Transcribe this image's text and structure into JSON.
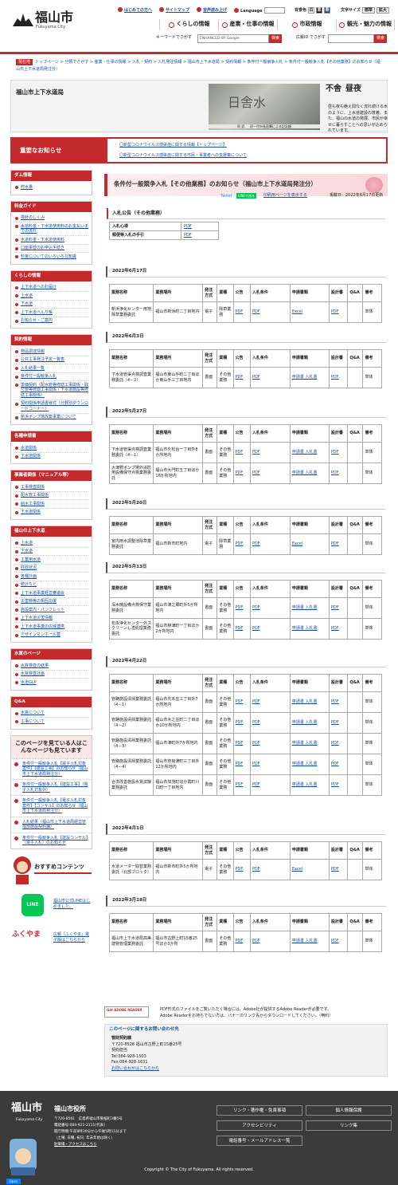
{
  "header": {
    "logo_jp": "福山市",
    "logo_en": "Fukuyama City",
    "toplinks": [
      "はじめての方へ",
      "サイトマップ",
      "音声読み上げ",
      "Language"
    ],
    "bg_label": "背景色",
    "bg_opts": [
      "白",
      "黒",
      "青"
    ],
    "fs_label": "文字サイズ",
    "fs_opts": [
      "標準",
      "拡大"
    ],
    "nav": [
      "くらしの情報",
      "産業・仕事の情報",
      "市政情報",
      "観光・魅力の情報"
    ],
    "search_label": "キーワードでさがす",
    "search_placeholder": "ENHANCED BY Google",
    "search_btn": "検索",
    "ad_label": "広報ID でさがす",
    "ad_btn": "検索"
  },
  "breadcrumb": {
    "home": "現在地",
    "trail": "トップページ > 分類でさがす > 産業・仕事の情報 > 入札・契約 > 入札発注情報 > 福山市上下水道局 > 契約情報 > 条件付一般競争入札 > 条件付一般競争入札【その他業務】のお知らせ（福山市上下水道局発注分）"
  },
  "dept": {
    "title": "福山市上下水道局",
    "caption": "阿 武 　 初一代市長直筆による記念額",
    "kanji": "日舎水",
    "cal1": "不舎",
    "cal2": "昼夜",
    "desc": "昼も夜も絶え間なく流れ続ける水のように、上水道建設の意義、また、福山の水道の発展、市民が幸せに暮らすことへの思いが込められています。"
  },
  "notice": {
    "label": "重要なお知らせ",
    "items": [
      "〇新型コロナウイルス感染症に関する情報【トップページ】",
      "〇新型コロナウイルス感染症に関する市民・事業者への支援策について"
    ]
  },
  "sidebar": {
    "groups": [
      {
        "title": "ダム情報",
        "items": [
          "貯水量"
        ]
      },
      {
        "title": "料金ガイド",
        "items": [
          "検針のしくみ",
          "水道料金・下水道使用料のお支払いまでの流れ",
          "水道料金・下水道使用料",
          "口座振替のお申込手続き",
          "料金についてのいろいろな知識"
        ]
      },
      {
        "title": "くらしの情報",
        "items": [
          "上下水道へのお届け",
          "上水道",
          "下水道",
          "上下水道べんり帳",
          "お知らせ・ご案内"
        ]
      },
      {
        "title": "契約情報",
        "items": [
          "物品調達情報",
          "公共工事発注予定一覧表",
          "入札結果一覧",
          "条件付一般競争入札",
          "単価契約（配水管等修繕工事関係・取付管等修繕工事関係・下水道施設等修繕工事関係）",
          "契約関係申請書様式（分野別ダウンロードコーナー）",
          "新浜ポンプ場改築事業について"
        ]
      },
      {
        "title": "各種申請書",
        "items": [
          "水道関係",
          "下水道関係"
        ]
      },
      {
        "title": "事業者関係（マニュアル等）",
        "items": [
          "工事検査関係",
          "配水管工事関係",
          "給水工事関係",
          "下水道関係"
        ]
      },
      {
        "title": "福山の上下水道",
        "items": [
          "上水道",
          "下水道",
          "工業用水道",
          "財政状況",
          "各種計画",
          "統計など",
          "上下水道事業経営審議会",
          "災害時等の相互応援",
          "施設案内・パンフレット",
          "上下水道災害情報",
          "上下水道事業の広域連携",
          "デザインマンホール蓋"
        ]
      },
      {
        "title": "水質のページ",
        "items": [
          "水質検査の結果",
          "水質検査計画",
          "水道GLP"
        ]
      },
      {
        "title": "Q&A",
        "items": [
          "水質について",
          "工事について"
        ]
      }
    ]
  },
  "popular": {
    "title": "このページを見ている人はこんなページも見ています",
    "items": [
      "条件付一般競争入札【電子入札対象案件】【建設工事】のお知らせ（福山市上下水道局発注分）",
      "条件付一般競争入札【建設工事】（電子入札対象外）",
      "条件付一般競争入札【電子入札対象案件】【コンサル】のお知らせ（福山市上下水道局発注分）",
      "入札結果（福山市上下水道局経営管理部施設契約課）",
      "条件付一般競争入札【建設コンサル】（電子入札）のお知らせ"
    ]
  },
  "recommend": {
    "title": "おすすめコンテンツ",
    "line_text": "福山市公式LINEはじめました。",
    "line_icon": "LINE",
    "fukuyama_text": "広報「ふくやま」電子版はこちらから",
    "fukuyama_icon": "ふくやま"
  },
  "main": {
    "title": "条件付一般競争入札【その他業務】のお知らせ（福山市上下水道局発注分）",
    "tweet": "Tweet",
    "line": "LINEで送る",
    "print": "印刷用ページを表示する",
    "date": "掲載日：2022年6月17日更新",
    "section": "入札公告（その他業務）",
    "pdfs": [
      {
        "name": "入札心得",
        "link": "PDF"
      },
      {
        "name": "郵便等入札の手引",
        "link": "PDF"
      }
    ],
    "headers": [
      "業務名称",
      "業務場所",
      "発注方式",
      "業種",
      "公告",
      "入札条件",
      "申請書類",
      "設計書",
      "Q&A",
      "備考"
    ],
    "blocks": [
      {
        "date": "2022年6月17日",
        "rows": [
          [
            "新浜浄化センター用地除草業務委託",
            "福山市新浜町二丁目地内",
            "電子",
            "除草業務",
            "PDF",
            "PDF",
            "Excel",
            "PDF",
            "",
            "単体"
          ]
        ]
      },
      {
        "date": "2022年6月3日",
        "rows": [
          [
            "下水道管渠点検調査業務委託（4－2）",
            "福山市東山手町二丁目ほか東山手三丁目地内",
            "書面",
            "その他業務",
            "PDF",
            "PDF",
            "申請書 入札書",
            "PDF",
            "",
            "単体"
          ]
        ]
      },
      {
        "date": "2022年5月27日",
        "rows": [
          [
            "下水道管渠点検調査業務委託（4－1）",
            "福山市久松台一丁目外8か所地内",
            "書面",
            "その他業務",
            "PDF",
            "PDF",
            "申請書 入札書",
            "PDF",
            "",
            "単体"
          ],
          [
            "大津野ポンプ場外消防用設備保守点検業務委託",
            "福山市大門町五丁目ほか16か所地内",
            "書面",
            "その他業務",
            "PDF",
            "PDF",
            "申請書 入札書",
            "PDF",
            "",
            "単体"
          ]
        ]
      },
      {
        "date": "2022年5月20日",
        "rows": [
          [
            "宮内雨水調整池除草業務委託",
            "福山市新市町地内",
            "電子",
            "除草業務",
            "PDF",
            "PDF",
            "Excel",
            "PDF",
            "",
            "単体"
          ]
        ]
      },
      {
        "date": "2022年5月13日",
        "rows": [
          [
            "深水機設備点検保守業務委託",
            "福山市津之郷町外5か所地内",
            "書面",
            "その他業務",
            "PDF",
            "PDF",
            "申請書 入札書",
            "PDF",
            "",
            "単体"
          ],
          [
            "松永浄化センター外スクリーンし渣処理業務委託",
            "福山市柳津町一丁目ほか2か所地内",
            "書面",
            "その他業務",
            "PDF",
            "PDF",
            "申請書 入札書",
            "PDF",
            "",
            "単体"
          ]
        ]
      },
      {
        "date": "2022年4月22日",
        "rows": [
          [
            "管路施設清掃業務委託（4－1）",
            "福山市元本庄三丁目外7か所地内",
            "書面",
            "その他業務",
            "PDF",
            "PDF",
            "申請書 入札書",
            "PDF",
            "",
            "単体"
          ],
          [
            "管路施設清掃業務委託（4－2）",
            "福山市木之庄町二丁目ほか10か所地内",
            "書面",
            "その他業務",
            "PDF",
            "PDF",
            "申請書 入札書",
            "PDF",
            "",
            "単体"
          ],
          [
            "管路施設清掃業務委託（4－3）",
            "福山市津町外7か所地内",
            "書面",
            "その他業務",
            "PDF",
            "PDF",
            "申請書 入札書",
            "PDF",
            "",
            "単体"
          ],
          [
            "管路施設清掃業務委託（4－4）",
            "福山市奈良津町三丁目外12か所地内",
            "書面",
            "その他業務",
            "PDF",
            "PDF",
            "申請書 入札書",
            "PDF",
            "",
            "単体"
          ],
          [
            "合流改善施設水質試験業務委託",
            "福山市加茂町ほか霞町川口町一丁目地内",
            "書面",
            "その他業務",
            "PDF",
            "PDF",
            "申請書 入札書",
            "PDF",
            "",
            "単体"
          ]
        ]
      },
      {
        "date": "2022年4月1日",
        "rows": [
          [
            "水道メーター取替業務委託（北部ブロック）",
            "福山市新市町外5か所地内",
            "電子",
            "その他業務",
            "PDF",
            "PDF",
            "Excel",
            "PDF",
            "",
            "単体"
          ]
        ]
      },
      {
        "date": "2022年3月18日",
        "rows": [
          [
            "福山市上下水道局高美建物管理業務委託",
            "福山市古野上町15番25号ほか3か所",
            "書面",
            "その他業務",
            "PDF",
            "PDF",
            "申請書 入札書",
            "PDF",
            "",
            "単体"
          ]
        ]
      }
    ],
    "adobe_badge": "Get ADOBE READER",
    "adobe_text1": "PDF形式のファイルをご覧いただく場合には、Adobe社が提供するAdobe Readerが必要です。",
    "adobe_text2": "Adobe Readerをお持ちでない方は、バナーのリンク先からダウンロードしてください。（無料）",
    "inquiry_title": "このページに関するお問い合わせ先",
    "inquiry": [
      "管財契約課",
      "〒720-8528 福山市古野上町15番25号",
      "契約担当",
      "Tel:084-928-1503",
      "Fax:084-928-1631",
      "お問い合わせはこちらから"
    ]
  },
  "footer": {
    "logo": "福山市",
    "logo_en": "Fukuyama City",
    "city": "福山市役所",
    "addr1": "〒720-8501　広島県福山市東桜町3番5号",
    "addr2": "電話番号:084-921-2111(代表)",
    "addr3": "開庁時間:午前8時30分から午後5時15分まで",
    "addr4": "（土曜, 日曜, 祝日, 年末年始は除く）",
    "addr5": "駐車場・アクセスはこちら",
    "links": [
      "リンク・著作権・免責事項",
      "個人情報保護",
      "アクセシビリティ",
      "リンク集",
      "電話番号・メールアドレス一覧"
    ],
    "copyright": "Copyright © The City of Fukuyama. All rights reserved.",
    "open": "Open"
  }
}
